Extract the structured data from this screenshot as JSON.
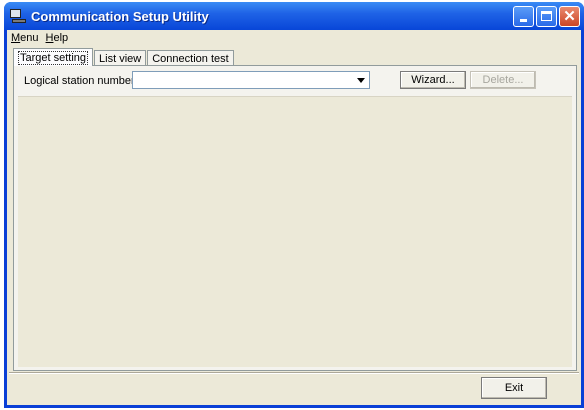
{
  "window": {
    "title": "Communication Setup Utility",
    "title_icon": "computer-icon",
    "controls": {
      "minimize": "minimize-icon",
      "maximize": "maximize-icon",
      "close": "close-icon",
      "close_glyph": "✕"
    }
  },
  "menubar": {
    "items": [
      {
        "label": "Menu",
        "accel": "M",
        "rest": "enu"
      },
      {
        "label": "Help",
        "accel": "H",
        "rest": "elp"
      }
    ]
  },
  "tabs": [
    {
      "label": "Target setting",
      "active": true
    },
    {
      "label": "List view",
      "active": false
    },
    {
      "label": "Connection test",
      "active": false
    }
  ],
  "target_setting": {
    "logical_station_label": "Logical station number",
    "logical_station_value": "",
    "wizard_label": "Wizard...",
    "delete_label": "Delete..."
  },
  "footer": {
    "exit_label": "Exit"
  },
  "colors": {
    "titlebar": "#0846d8",
    "client": "#ece9d8",
    "panel": "#f4f3ee",
    "close_button": "#cd4626"
  }
}
